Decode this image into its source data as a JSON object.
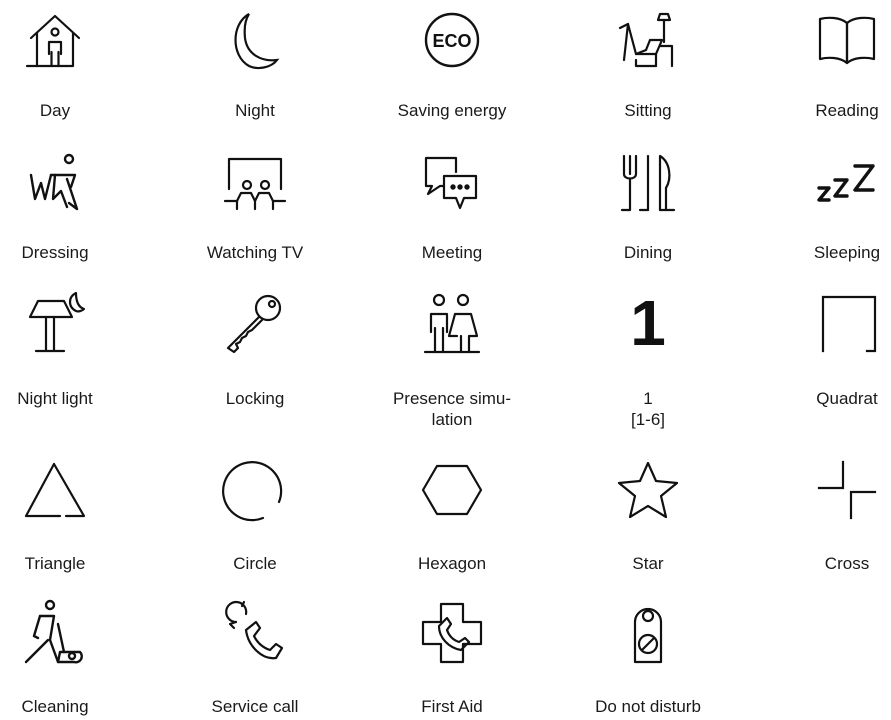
{
  "icons": [
    {
      "label": "Day",
      "icon": "house-person-icon"
    },
    {
      "label": "Night",
      "icon": "moon-icon"
    },
    {
      "label": "Saving energy",
      "icon": "eco-icon",
      "icon_text": "ECO"
    },
    {
      "label": "Sitting",
      "icon": "armchair-lamp-icon"
    },
    {
      "label": "Reading",
      "icon": "open-book-icon"
    },
    {
      "label": "Dressing",
      "icon": "dressing-icon"
    },
    {
      "label": "Watching TV",
      "icon": "watching-tv-icon"
    },
    {
      "label": "Meeting",
      "icon": "meeting-chat-icon"
    },
    {
      "label": "Dining",
      "icon": "dining-cutlery-icon"
    },
    {
      "label": "Sleeping",
      "icon": "sleeping-zzz-icon",
      "icon_text": "ZZZ"
    },
    {
      "label": "Night light",
      "icon": "night-lamp-icon"
    },
    {
      "label": "Locking",
      "icon": "key-icon"
    },
    {
      "label_line1": "Presence simu-",
      "label_line2": "lation",
      "icon": "presence-people-icon"
    },
    {
      "label_line1": "1",
      "label_line2": "[1-6]",
      "icon": "number-one-icon",
      "icon_text": "1"
    },
    {
      "label": "Quadrat",
      "icon": "square-icon"
    },
    {
      "label": "Triangle",
      "icon": "triangle-icon"
    },
    {
      "label": "Circle",
      "icon": "circle-icon"
    },
    {
      "label": "Hexagon",
      "icon": "hexagon-icon"
    },
    {
      "label": "Star",
      "icon": "star-icon"
    },
    {
      "label": "Cross",
      "icon": "cross-icon"
    },
    {
      "label": "Cleaning",
      "icon": "cleaning-vacuum-icon"
    },
    {
      "label": "Service call",
      "icon": "service-call-icon"
    },
    {
      "label": "First Aid",
      "icon": "first-aid-phone-icon"
    },
    {
      "label": "Do not disturb",
      "icon": "door-hanger-icon"
    }
  ]
}
